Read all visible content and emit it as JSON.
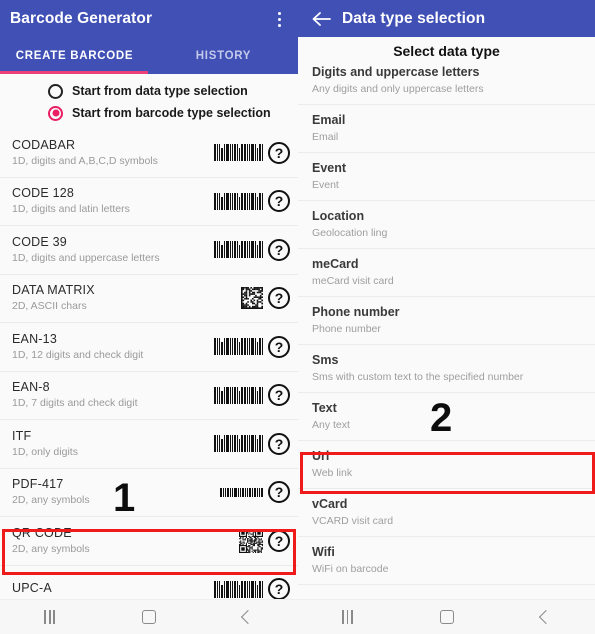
{
  "left": {
    "appbar": {
      "title": "Barcode Generator",
      "overflow_icon": "kebab-menu-icon"
    },
    "tabs": [
      {
        "label": "CREATE BARCODE",
        "active": true
      },
      {
        "label": "HISTORY",
        "active": false
      }
    ],
    "radios": [
      {
        "label": "Start from data type selection",
        "selected": false
      },
      {
        "label": "Start from barcode type selection",
        "selected": true
      }
    ],
    "barcode_types": [
      {
        "name": "CODABAR",
        "desc": "1D, digits and A,B,C,D symbols",
        "glyph": "barcode-1d"
      },
      {
        "name": "CODE 128",
        "desc": "1D, digits and latin letters",
        "glyph": "barcode-1d"
      },
      {
        "name": "CODE 39",
        "desc": "1D, digits and uppercase letters",
        "glyph": "barcode-1d"
      },
      {
        "name": "DATA MATRIX",
        "desc": "2D, ASCII chars",
        "glyph": "datamatrix"
      },
      {
        "name": "EAN-13",
        "desc": "1D, 12 digits and check digit",
        "glyph": "barcode-1d"
      },
      {
        "name": "EAN-8",
        "desc": "1D, 7 digits and check digit",
        "glyph": "barcode-1d"
      },
      {
        "name": "ITF",
        "desc": "1D, only digits",
        "glyph": "barcode-1d"
      },
      {
        "name": "PDF-417",
        "desc": "2D, any symbols",
        "glyph": "pdf417"
      },
      {
        "name": "QR CODE",
        "desc": "2D, any symbols",
        "glyph": "qr",
        "highlighted": true
      },
      {
        "name": "UPC-A",
        "desc": "",
        "glyph": "barcode-1d"
      }
    ],
    "annotation": "1"
  },
  "right": {
    "appbar": {
      "title": "Data type selection",
      "back_icon": "back-arrow-icon"
    },
    "sheet_title": "Select data type",
    "data_types": [
      {
        "name": "Digits and uppercase letters",
        "desc": "Any digits and only uppercase letters"
      },
      {
        "name": "Email",
        "desc": "Email"
      },
      {
        "name": "Event",
        "desc": "Event"
      },
      {
        "name": "Location",
        "desc": "Geolocation ling"
      },
      {
        "name": "meCard",
        "desc": "meCard visit card"
      },
      {
        "name": "Phone number",
        "desc": "Phone number"
      },
      {
        "name": "Sms",
        "desc": "Sms with custom text to the specified number"
      },
      {
        "name": "Text",
        "desc": "Any text"
      },
      {
        "name": "Url",
        "desc": "Web link",
        "highlighted": true
      },
      {
        "name": "vCard",
        "desc": "VCARD visit card"
      },
      {
        "name": "Wifi",
        "desc": "WiFi on barcode"
      }
    ],
    "annotation": "2"
  },
  "navbar": {
    "recents_icon": "recents-icon",
    "home_icon": "home-icon",
    "back_icon": "back-icon"
  },
  "colors": {
    "appbar": "#4050b5",
    "accent_pink": "#e91e63",
    "highlight_red": "#ef1b1b",
    "panel_bg": "#fafafa"
  }
}
